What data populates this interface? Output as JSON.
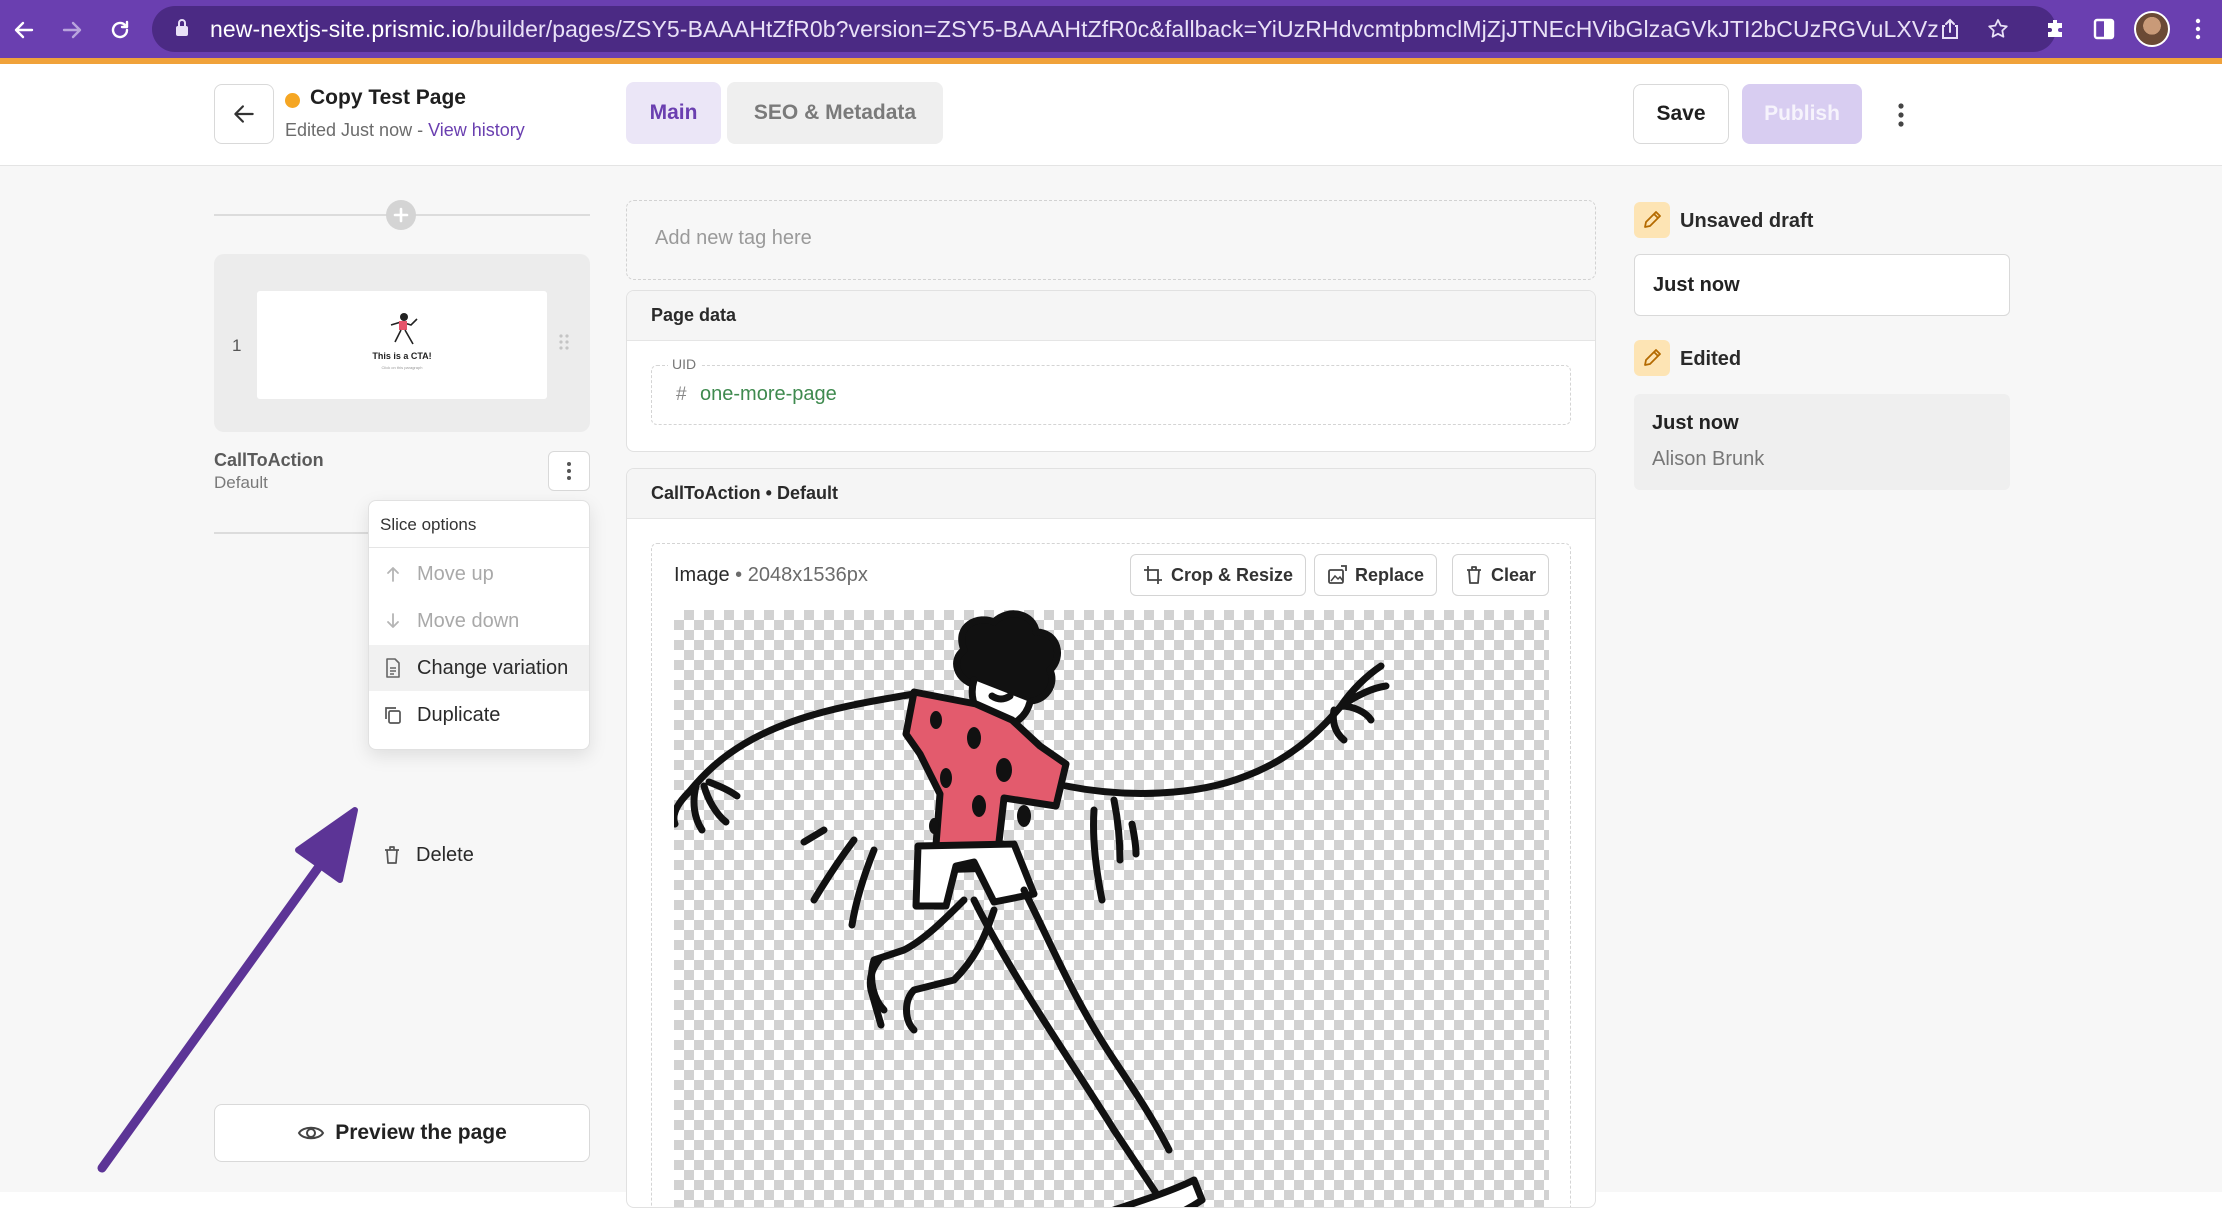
{
  "browser": {
    "url_host": "new-nextjs-site.prismic.io",
    "url_path": "/builder/pages/ZSY5-BAAAHtZfR0b?version=ZSY5-BAAAHtZfR0c&fallback=YiUzRHdvcmtpbmclMjZjJTNEcHVibGlzaGVkJTI2bCUzRGVuLXVz"
  },
  "header": {
    "page_title": "Copy Test Page",
    "edited_prefix": "Edited Just now - ",
    "view_history": "View history",
    "tabs": [
      {
        "label": "Main"
      },
      {
        "label": "SEO & Metadata"
      }
    ],
    "save_label": "Save",
    "publish_label": "Publish"
  },
  "sidebar": {
    "slice": {
      "index": "1",
      "thumb_text": "This is a CTA!",
      "thumb_sub": "Click on this paragraph",
      "name": "CallToAction",
      "variation": "Default"
    },
    "menu": {
      "header": "Slice options",
      "items": [
        {
          "label": "Move up",
          "icon": "arrow-up-icon"
        },
        {
          "label": "Move down",
          "icon": "arrow-down-icon"
        },
        {
          "label": "Change variation",
          "icon": "document-icon"
        },
        {
          "label": "Duplicate",
          "icon": "copy-icon"
        },
        {
          "label": "Delete",
          "icon": "trash-icon"
        }
      ]
    },
    "preview_label": "Preview the page"
  },
  "main": {
    "tag_placeholder": "Add new tag here",
    "page_data": {
      "title": "Page data",
      "uid_label": "UID",
      "uid_value": "one-more-page"
    },
    "cta": {
      "title": "CallToAction • Default",
      "image_label": "Image",
      "image_size": "2048x1536px",
      "crop_label": "Crop & Resize",
      "replace_label": "Replace",
      "clear_label": "Clear"
    }
  },
  "status": {
    "draft_title": "Unsaved draft",
    "draft_time": "Just now",
    "edited_title": "Edited",
    "edited_time": "Just now",
    "edited_author": "Alison Brunk"
  },
  "colors": {
    "accent": "#6a3fb0",
    "browser_bar": "#6a3fb0",
    "status_dot": "#f5a623",
    "uid_green": "#3f8a4f"
  }
}
